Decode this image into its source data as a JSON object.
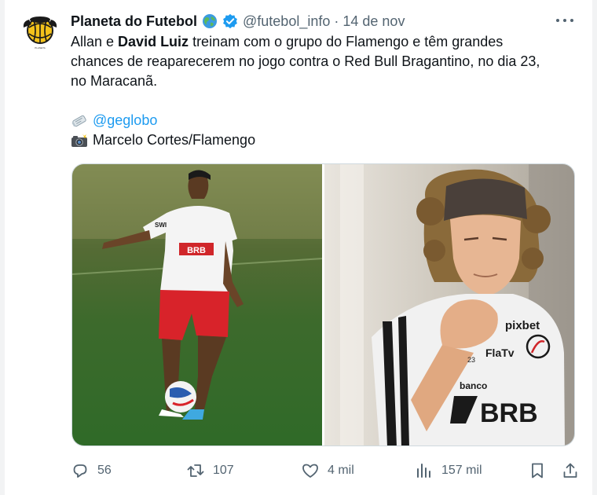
{
  "tweet": {
    "author": {
      "name": "Planeta do Futebol",
      "handle": "@futebol_info",
      "date": "14 de nov",
      "avatar_icon": "planeta-do-futebol-logo",
      "verified_icon": "verified-badge-icon",
      "globe_emoji_icon": "globe-icon"
    },
    "more_icon": "more-options-icon",
    "text": {
      "line1_pre": "Allan e ",
      "line1_bold": "David Luiz",
      "line1_post": " treinam com o grupo do Flamengo e têm grandes",
      "line2": "chances de reaparecerem no jogo contra o Red Bull Bragantino, no dia 23,",
      "line3": "no Maracanã.",
      "source_icon": "newspaper-icon",
      "source_link": "@geglobo",
      "photo_icon": "camera-flash-icon",
      "photo_credit": "Marcelo Cortes/Flamengo"
    },
    "media": [
      {
        "description_icon": "allan-training-photo"
      },
      {
        "description_icon": "david-luiz-portrait-photo",
        "shirt_text": [
          "pixbet",
          "FlaTv",
          "banco",
          "BRB",
          "23"
        ]
      }
    ],
    "left_shirt_text": [
      "BRB",
      "SWI"
    ],
    "actions": {
      "reply": {
        "icon": "reply-icon",
        "count": "56"
      },
      "retweet": {
        "icon": "retweet-icon",
        "count": "107"
      },
      "like": {
        "icon": "heart-icon",
        "count": "4 mil"
      },
      "views": {
        "icon": "views-icon",
        "count": "157 mil"
      },
      "bookmark": {
        "icon": "bookmark-icon"
      },
      "share": {
        "icon": "share-icon"
      }
    },
    "colors": {
      "link": "#1d9bf0",
      "muted": "#536471",
      "verified": "#1d9bf0",
      "flamengo_red": "#d0262a"
    }
  }
}
